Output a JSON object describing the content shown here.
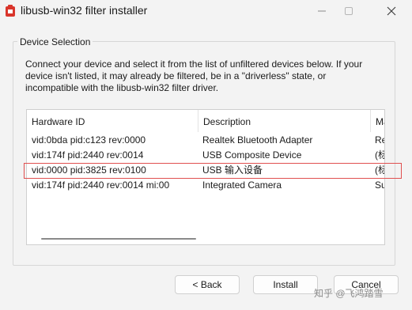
{
  "window": {
    "title": "libusb-win32 filter installer",
    "icon": "libusb-app-icon",
    "controls": {
      "minimize": "minimize-icon",
      "maximize": "maximize-icon",
      "close": "close-icon"
    }
  },
  "group": {
    "legend": "Device Selection",
    "description": "Connect your device and select it from the list of unfiltered devices below. If your device isn't listed, it may already be filtered, be in a \"driverless\" state, or incompatible with the libusb-win32 filter driver."
  },
  "list": {
    "columns": [
      "Hardware ID",
      "Description",
      "Ma"
    ],
    "rows": [
      {
        "hardware_id": "vid:0bda pid:c123 rev:0000",
        "description": "Realtek Bluetooth Adapter",
        "manufacturer": "Re"
      },
      {
        "hardware_id": "vid:174f pid:2440 rev:0014",
        "description": "USB Composite Device",
        "manufacturer": "(标"
      },
      {
        "hardware_id": "vid:0000 pid:3825 rev:0100",
        "description": "USB 输入设备",
        "manufacturer": "(标"
      },
      {
        "hardware_id": "vid:174f pid:2440 rev:0014 mi:00",
        "description": "Integrated Camera",
        "manufacturer": "Su"
      }
    ]
  },
  "buttons": {
    "back": "< Back",
    "install": "Install",
    "cancel": "Cancel"
  },
  "watermark": "知乎 @飞鸿踏雪",
  "colors": {
    "highlight": "#e05050",
    "app_icon": "#d9352b"
  }
}
